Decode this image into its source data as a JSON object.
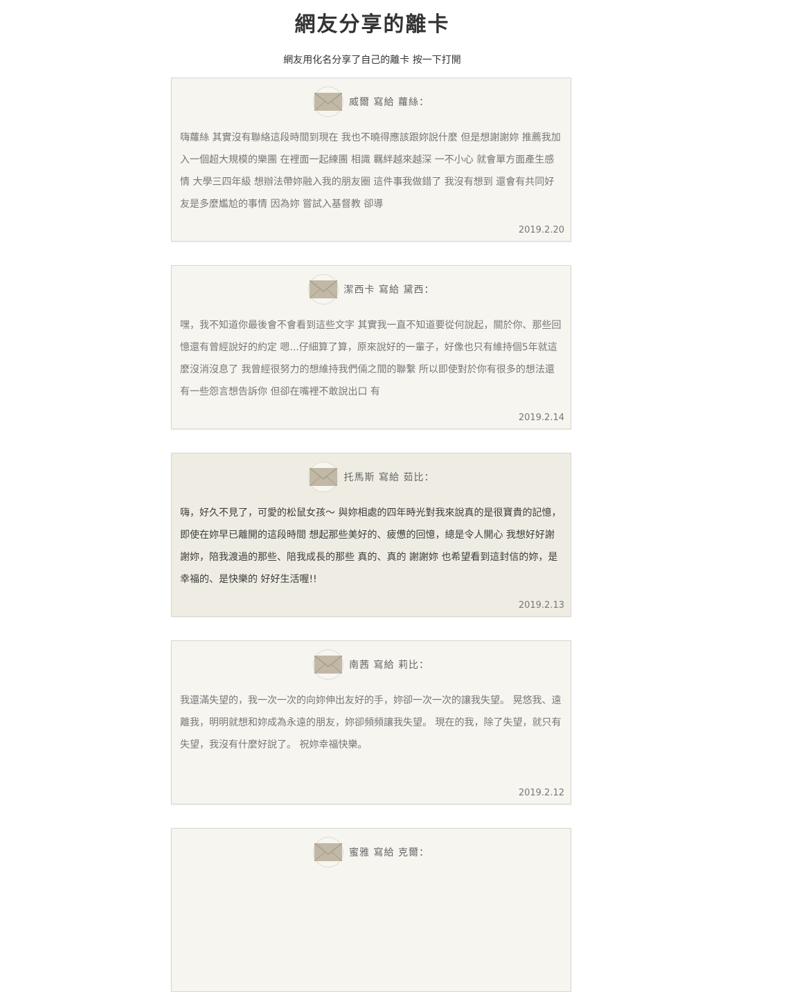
{
  "page": {
    "title": "網友分享的離卡",
    "subtitle": "網友用化名分享了自己的離卡 按一下打開"
  },
  "cards": [
    {
      "header": "威爾 寫給 蘿絲：",
      "body": "嗨蘿絲 其實沒有聯絡這段時間到現在 我也不曉得應該跟妳說什麼 但是想謝謝妳 推薦我加入一個超大規模的樂團 在裡面一起練團 相識 羈絆越來越深 一不小心 就會單方面產生感情 大學三四年級 想辦法帶妳融入我的朋友圈 這件事我做錯了 我沒有想到 還會有共同好友是多麼尷尬的事情 因為妳 嘗試入基督教 卻導",
      "date": "2019.2.20"
    },
    {
      "header": "潔西卡 寫給 黛西：",
      "body": "嘿，我不知道你最後會不會看到這些文字 其實我一直不知道要從何說起，關於你、那些回憶還有曾經說好的約定 嗯...仔細算了算，原來說好的一輩子，好像也只有維持個5年就這麼沒消沒息了 我曾經很努力的想維持我們倆之間的聯繫 所以即使對於你有很多的想法還有一些怨言想告訴你 但卻在嘴裡不敢說出口 有",
      "date": "2019.2.14"
    },
    {
      "header": "托馬斯 寫給 茹比：",
      "body": "嗨，好久不見了，可愛的松鼠女孩～ 與妳相處的四年時光對我來說真的是很寶貴的記憶，即使在妳早已離開的這段時間 想起那些美好的、疲憊的回憶，總是令人開心 我想好好謝謝妳，陪我渡過的那些、陪我成長的那些 真的、真的 謝謝妳 也希望看到這封信的妳，是幸福的、是快樂的 好好生活喔!!",
      "date": "2019.2.13"
    },
    {
      "header": "南茜 寫給 莉比：",
      "body": "我還滿失望的，我一次一次的向妳伸出友好的手，妳卻一次一次的讓我失望。 晃悠我、遠離我，明明就想和妳成為永遠的朋友，妳卻頻頻讓我失望。 現在的我，除了失望，就只有失望，我沒有什麼好說了。 祝妳幸福快樂。",
      "date": "2019.2.12"
    },
    {
      "header": "蜜雅 寫給 克爾：",
      "body": "",
      "date": ""
    }
  ]
}
